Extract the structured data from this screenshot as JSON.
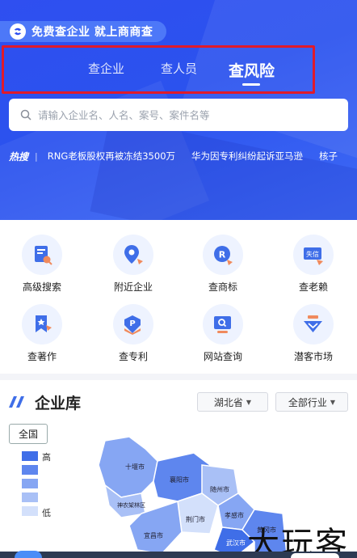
{
  "brand": {
    "text": "免费查企业 就上商商查"
  },
  "tabs": [
    {
      "label": "查企业",
      "active": false
    },
    {
      "label": "查人员",
      "active": false
    },
    {
      "label": "查风险",
      "active": true
    }
  ],
  "search": {
    "placeholder": "请输入企业名、人名、案号、案件名等"
  },
  "hot": {
    "label": "热搜",
    "items": [
      "RNG老板股权再被冻结3500万",
      "华为因专利纠纷起诉亚马逊",
      "核子"
    ]
  },
  "functions": [
    {
      "label": "高级搜索",
      "icon": "advanced-search-icon"
    },
    {
      "label": "附近企业",
      "icon": "nearby-location-icon"
    },
    {
      "label": "查商标",
      "icon": "trademark-icon"
    },
    {
      "label": "查老赖",
      "icon": "dishonest-debtor-icon",
      "badge": "失信"
    },
    {
      "label": "查著作",
      "icon": "copyright-icon"
    },
    {
      "label": "查专利",
      "icon": "patent-icon"
    },
    {
      "label": "网站查询",
      "icon": "website-search-icon"
    },
    {
      "label": "潜客市场",
      "icon": "prospect-market-icon"
    }
  ],
  "library": {
    "title": "企业库",
    "province": "湖北省",
    "industry": "全部行业",
    "scope_button": "全国",
    "legend": {
      "high": "高",
      "low": "低"
    },
    "legend_colors": [
      "#3f6ee8",
      "#5e86ee",
      "#86a6f3",
      "#a9c0f6",
      "#d3e0fb"
    ],
    "map_cities": [
      "十堰市",
      "襄阳市",
      "随州市",
      "神农架林区",
      "荆门市",
      "孝感市",
      "宜昌市",
      "武汉市",
      "黄冈市"
    ]
  },
  "watermark": "大玩客",
  "colors": {
    "accent": "#2f4ff0",
    "highlight_box": "#e01a2a"
  }
}
